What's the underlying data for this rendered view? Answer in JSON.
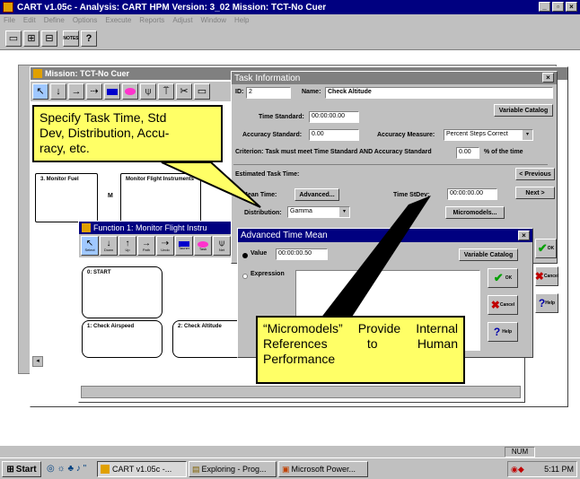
{
  "app": {
    "title": "CART v1.05c - Analysis: CART HPM  Version: 3_02  Mission: TCT-No Cuer",
    "menu": [
      "File",
      "Edit",
      "Define",
      "Options",
      "Execute",
      "Reports",
      "Adjust",
      "Window",
      "Help"
    ],
    "toolbar_notes_label": "NOTES",
    "toolbar_help_glyph": "?"
  },
  "mission_window": {
    "title": "Mission: TCT-No Cuer",
    "node_flight": "Monitor Flight Instruments",
    "node_m": "M",
    "node_left": "3. Monitor Fuel"
  },
  "function_window": {
    "title": "Function 1: Monitor Flight Instru",
    "tools": [
      "Select",
      "Down",
      "Up",
      "Path",
      "Undo",
      "Tauner",
      "Task",
      "Net"
    ],
    "node_start": "0: START",
    "node_check_airspeed": "1: Check Airspeed",
    "node_check_altitude": "2: Check Altitude"
  },
  "task_info": {
    "title": "Task Information",
    "id_label": "ID:",
    "id_value": "2",
    "name_label": "Name:",
    "name_value": "Check Altitude",
    "variable_catalog": "Variable Catalog",
    "time_standard_label": "Time Standard:",
    "time_standard_value": "00:00:00.00",
    "accuracy_standard_label": "Accuracy Standard:",
    "accuracy_standard_value": "0.00",
    "accuracy_measure_label": "Accuracy Measure:",
    "accuracy_measure_value": "Percent Steps Correct",
    "criterion_text": "Criterion:  Task must meet Time Standard AND Accuracy Standard",
    "criterion_value": "0.00",
    "criterion_suffix": "% of the time",
    "estimated_label": "Estimated Task Time:",
    "mean_time_label": "Mean Time:",
    "advanced_button": "Advanced...",
    "time_stdev_label": "Time StDev:",
    "time_stdev_value": "00:00:00.00",
    "distribution_label": "Distribution:",
    "distribution_value": "Gamma",
    "micromodels_button": "Micromodels...",
    "previous_button": "< Previous",
    "next_button": "Next >",
    "ok_button": "OK",
    "cancel_button": "Cancel",
    "help_button": "Help"
  },
  "advanced_time_mean": {
    "title": "Advanced Time Mean",
    "value_label": "Value",
    "value_field": "00:00:00.50",
    "expression_label": "Expression",
    "variable_catalog": "Variable Catalog",
    "ok_button": "OK",
    "cancel_button": "Cancel",
    "help_button": "Help"
  },
  "callouts": {
    "task_time": "Specify Task Time, Std Dev, Distribution, Accuracy, etc.",
    "task_time_visible": "Specify Task Time, Std\nDev, Distribution, Accu-\nracy, etc.",
    "micromodels": "“Micromodels” Provide Internal References to Human Performance"
  },
  "status_bar": {
    "num": "NUM"
  },
  "taskbar": {
    "start": "Start",
    "tasks": [
      "CART v1.05c -...",
      "Exploring - Prog...",
      "Microsoft Power..."
    ],
    "clock": "5:11 PM"
  },
  "colors": {
    "titlebar": "#000080",
    "callout": "#ffff66",
    "desktop": "#ffffff",
    "chrome": "#c0c0c0"
  }
}
